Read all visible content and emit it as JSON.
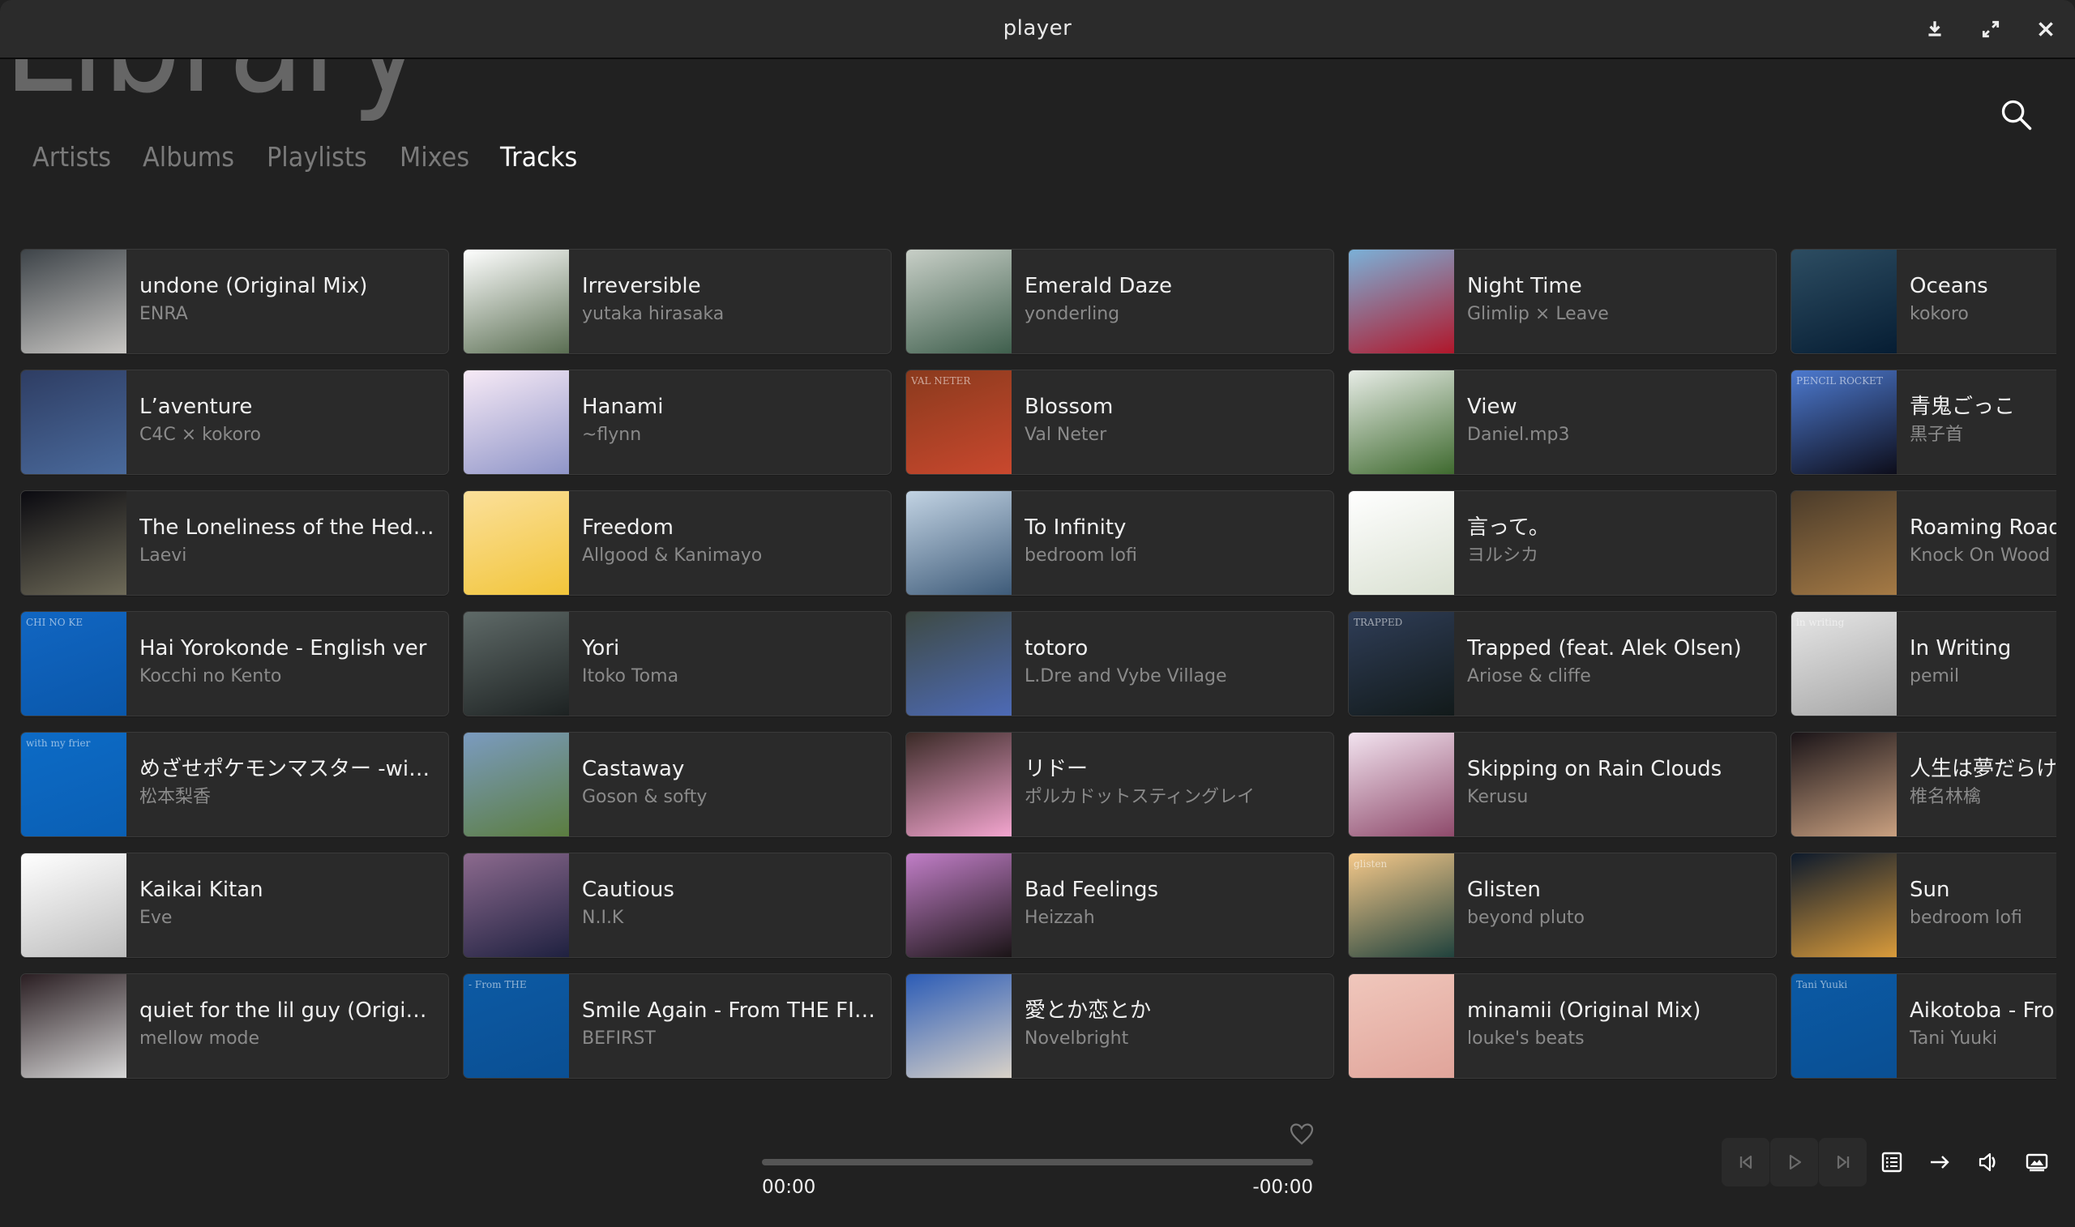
{
  "window": {
    "title": "player",
    "controls": [
      "download-icon",
      "maximize-icon",
      "close-icon"
    ]
  },
  "header": {
    "title": "Library",
    "tabs": [
      {
        "label": "Artists",
        "active": false
      },
      {
        "label": "Albums",
        "active": false
      },
      {
        "label": "Playlists",
        "active": false
      },
      {
        "label": "Mixes",
        "active": false
      },
      {
        "label": "Tracks",
        "active": true
      }
    ],
    "search_icon": "search-icon"
  },
  "tracks": [
    {
      "title": "undone (Original Mix)",
      "artist": "ENRA",
      "art": [
        "#3e4449",
        "#c9c7c4"
      ],
      "art_label": ""
    },
    {
      "title": "Irreversible",
      "artist": "yutaka hirasaka",
      "art": [
        "#ffffff",
        "#5a6e52"
      ],
      "art_label": ""
    },
    {
      "title": "Emerald Daze",
      "artist": "yonderling",
      "art": [
        "#c8cfc7",
        "#3f5f4d"
      ],
      "art_label": ""
    },
    {
      "title": "Night Time",
      "artist": "Glimlip × Leave",
      "art": [
        "#7bb1d8",
        "#b0162a"
      ],
      "art_label": ""
    },
    {
      "title": "Oceans",
      "artist": "kokoro",
      "art": [
        "#2d4d62",
        "#061d33"
      ],
      "art_label": ""
    },
    {
      "title": "L’aventure",
      "artist": "C4C × kokoro",
      "art": [
        "#2e3d63",
        "#4a6a9c"
      ],
      "art_label": ""
    },
    {
      "title": "Hanami",
      "artist": "~flynn",
      "art": [
        "#f7eaf6",
        "#8f95c8"
      ],
      "art_label": ""
    },
    {
      "title": "Blossom",
      "artist": "Val Neter",
      "art": [
        "#8a3a1d",
        "#c9482e"
      ],
      "art_label": "VAL NETER"
    },
    {
      "title": "View",
      "artist": "Daniel.mp3",
      "art": [
        "#e7ece6",
        "#3f6a2f"
      ],
      "art_label": ""
    },
    {
      "title": "青鬼ごっこ",
      "artist": "黒子首",
      "art": [
        "#4d7ad0",
        "#0d0d1a"
      ],
      "art_label": "PENCIL ROCKET"
    },
    {
      "title": "The Loneliness of the Hedgehog",
      "artist": "Laevi",
      "art": [
        "#0a0a10",
        "#6e6a58"
      ],
      "art_label": ""
    },
    {
      "title": "Freedom",
      "artist": "Allgood & Kanimayo",
      "art": [
        "#fbe09b",
        "#f2c53a"
      ],
      "art_label": ""
    },
    {
      "title": "To Infinity",
      "artist": "bedroom lofi",
      "art": [
        "#c2d3e3",
        "#3e5b79"
      ],
      "art_label": ""
    },
    {
      "title": "言って。",
      "artist": "ヨルシカ",
      "art": [
        "#ffffff",
        "#d9e0d1"
      ],
      "art_label": ""
    },
    {
      "title": "Roaming Roads",
      "artist": "Knock On Wood",
      "art": [
        "#4a3b2a",
        "#a57a45"
      ],
      "art_label": ""
    },
    {
      "title": "Hai Yorokonde - English ver",
      "artist": "Kocchi no Kento",
      "art": [
        "#1166c2",
        "#0a57aa"
      ],
      "art_label": "CHI NO KE"
    },
    {
      "title": "Yori",
      "artist": "Itoko Toma",
      "art": [
        "#5f6a68",
        "#1d2222"
      ],
      "art_label": ""
    },
    {
      "title": "totoro",
      "artist": "L.Dre and Vybe Village",
      "art": [
        "#3e4a44",
        "#4d6ab6"
      ],
      "art_label": ""
    },
    {
      "title": "Trapped (feat. Alek Olsen)",
      "artist": "Ariose & cliffe",
      "art": [
        "#2f3d57",
        "#121a1a"
      ],
      "art_label": "TRAPPED"
    },
    {
      "title": "In Writing",
      "artist": "pemil",
      "art": [
        "#e6e6e6",
        "#a6a6a6"
      ],
      "art_label": "in writing"
    },
    {
      "title": "めざせポケモンマスター -with my friends-",
      "artist": "松本梨香",
      "art": [
        "#0d6bc6",
        "#0a5fb4"
      ],
      "art_label": "with my frier"
    },
    {
      "title": "Castaway",
      "artist": "Goson & softy",
      "art": [
        "#7b9bc0",
        "#5b7d3f"
      ],
      "art_label": ""
    },
    {
      "title": "リドー",
      "artist": "ポルカドットスティングレイ",
      "art": [
        "#3a2a26",
        "#f3a5cf"
      ],
      "art_label": ""
    },
    {
      "title": "Skipping on Rain Clouds",
      "artist": "Kerusu",
      "art": [
        "#f2e3ef",
        "#8e4a6b"
      ],
      "art_label": ""
    },
    {
      "title": "人生は夢だらけ",
      "artist": "椎名林檎",
      "art": [
        "#1a1418",
        "#c9a080"
      ],
      "art_label": ""
    },
    {
      "title": "Kaikai Kitan",
      "artist": "Eve",
      "art": [
        "#ffffff",
        "#bdbdbd"
      ],
      "art_label": ""
    },
    {
      "title": "Cautious",
      "artist": "N.I.K",
      "art": [
        "#8c6a8e",
        "#1f2140"
      ],
      "art_label": ""
    },
    {
      "title": "Bad Feelings",
      "artist": "Heizzah",
      "art": [
        "#c17ec7",
        "#1a1416"
      ],
      "art_label": ""
    },
    {
      "title": "Glisten",
      "artist": "beyond pluto",
      "art": [
        "#f6c98a",
        "#20423d"
      ],
      "art_label": "glisten"
    },
    {
      "title": "Sun",
      "artist": "bedroom lofi",
      "art": [
        "#0d1a2c",
        "#d99b3b"
      ],
      "art_label": ""
    },
    {
      "title": "quiet for the lil guy (Original Mix)",
      "artist": "mellow mode",
      "art": [
        "#2a1e22",
        "#d7d7d7"
      ],
      "art_label": ""
    },
    {
      "title": "Smile Again - From THE FIRST TAKE",
      "artist": "BEFIRST",
      "art": [
        "#0d5aa4",
        "#0a4f93"
      ],
      "art_label": "- From THE"
    },
    {
      "title": "愛とか恋とか",
      "artist": "Novelbright",
      "art": [
        "#2c5cb6",
        "#d9d2c8"
      ],
      "art_label": ""
    },
    {
      "title": "minamii (Original Mix)",
      "artist": "louke's beats",
      "art": [
        "#f0c7bc",
        "#e0a49a"
      ],
      "art_label": ""
    },
    {
      "title": "Aikotoba - From THE FIRST TAKE",
      "artist": "Tani Yuuki",
      "art": [
        "#0b5aa5",
        "#0a4f93"
      ],
      "art_label": "Tani Yuuki"
    }
  ],
  "player": {
    "elapsed": "00:00",
    "remaining": "-00:00",
    "progress_fraction": 0,
    "favorite": false,
    "controls": {
      "previous": "skip-previous-icon",
      "play": "play-icon",
      "next": "skip-next-icon",
      "queue": "queue-list-icon",
      "repeat": "arrow-right-icon",
      "volume": "volume-icon",
      "display": "picture-display-icon"
    }
  }
}
